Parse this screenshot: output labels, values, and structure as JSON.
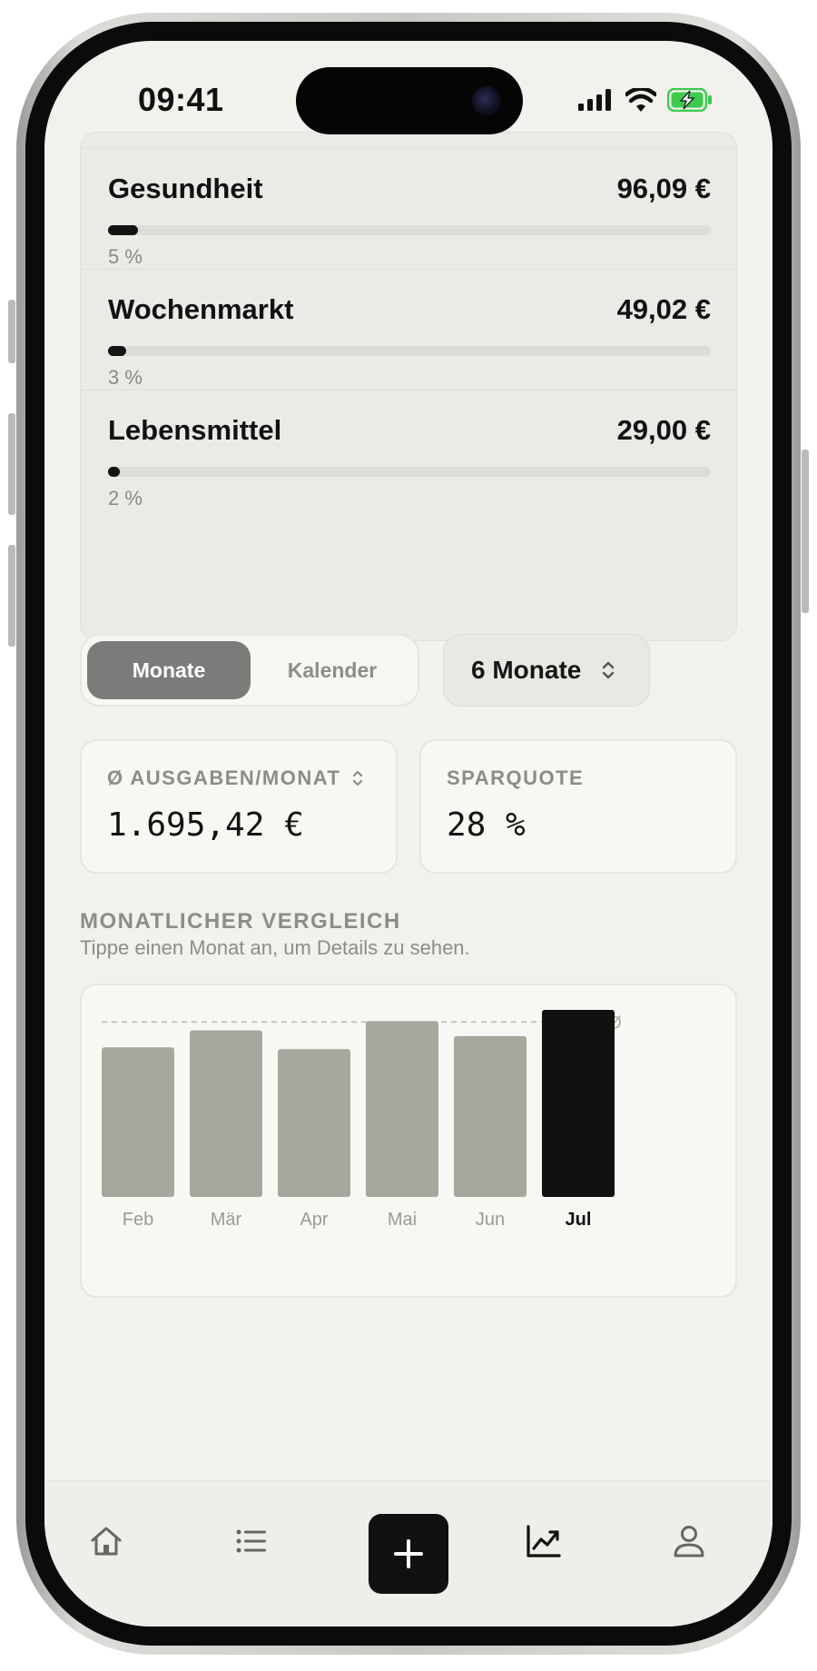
{
  "status_bar": {
    "time": "09:41"
  },
  "categories": [
    {
      "name": "Gesundheit",
      "amount": "96,09 €",
      "percent_label": "5 %",
      "share": 0.05
    },
    {
      "name": "Wochenmarkt",
      "amount": "49,02 €",
      "percent_label": "3 %",
      "share": 0.03
    },
    {
      "name": "Lebensmittel",
      "amount": "29,00 €",
      "percent_label": "2 %",
      "share": 0.02
    }
  ],
  "view_toggle": {
    "options": [
      "Monate",
      "Kalender"
    ],
    "selected": "Monate"
  },
  "range_selector": {
    "label": "6 Monate"
  },
  "stats": {
    "avg_expenses": {
      "label": "Ø AUSGABEN/MONAT",
      "value": "1.695,42 €"
    },
    "savings_rate": {
      "label": "SPARQUOTE",
      "value": "28 %"
    }
  },
  "comparison": {
    "title": "MONATLICHER VERGLEICH",
    "subtitle": "Tippe einen Monat an, um Details zu sehen.",
    "average_marker": "Ø",
    "selected_month": "Jul"
  },
  "chart_data": {
    "type": "bar",
    "categories": [
      "Feb",
      "Mär",
      "Apr",
      "Mai",
      "Jun",
      "Jul"
    ],
    "values": [
      0.8,
      0.89,
      0.79,
      0.94,
      0.86,
      1.0
    ],
    "average": 0.935,
    "highlighted": "Jul",
    "colors": {
      "default": "#a7a79d",
      "highlight": "#111111"
    }
  },
  "tabbar": {
    "items": [
      "home-icon",
      "list-icon",
      "add-icon",
      "chart-icon",
      "profile-icon"
    ],
    "active": "chart-icon"
  }
}
